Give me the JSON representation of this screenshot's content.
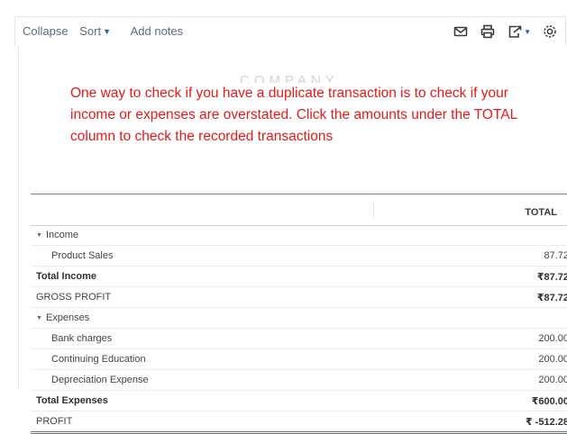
{
  "toolbar": {
    "collapse_label": "Collapse",
    "sort_label": "Sort",
    "add_notes_label": "Add notes",
    "icons": [
      "email-icon",
      "print-icon",
      "export-icon",
      "settings-icon"
    ]
  },
  "report": {
    "ghost_title": "COMPANY",
    "annotation": "One way to check if you have a duplicate transaction is to check if your income or expenses are overstated. Click the amounts under the TOTAL column to check the recorded transactions",
    "annotation_color": "#e31b1b",
    "column_header": "TOTAL",
    "rows": {
      "income_header": "Income",
      "product_sales": {
        "label": "Product Sales",
        "amount": "87.72"
      },
      "total_income": {
        "label": "Total Income",
        "amount": "₹87.72"
      },
      "gross_profit": {
        "label": "GROSS PROFIT",
        "amount": "₹87.72"
      },
      "expenses_header": "Expenses",
      "bank_charges": {
        "label": "Bank charges",
        "amount": "200.00"
      },
      "continuing_education": {
        "label": "Continuing Education",
        "amount": "200.00"
      },
      "depreciation_expense": {
        "label": "Depreciation Expense",
        "amount": "200.00"
      },
      "total_expenses": {
        "label": "Total Expenses",
        "amount": "₹600.00"
      },
      "profit": {
        "label": "PROFIT",
        "amount": "₹ -512.28"
      }
    }
  }
}
